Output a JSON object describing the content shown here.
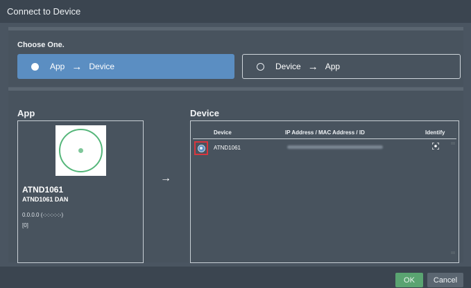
{
  "window": {
    "title": "Connect to Device"
  },
  "mode": {
    "heading": "Choose One.",
    "options": [
      {
        "from": "App",
        "to": "Device",
        "selected": true
      },
      {
        "from": "Device",
        "to": "App",
        "selected": false
      }
    ]
  },
  "app": {
    "title": "App",
    "name": "ATND1061",
    "dan_name": "ATND1061 DAN",
    "address": "0.0.0.0 (-:-:-:-:-:-)",
    "id": "[0]"
  },
  "transfer_arrow": "→",
  "device": {
    "title": "Device",
    "columns": [
      "Device",
      "IP Address / MAC Address / ID",
      "Identify"
    ],
    "rows": [
      {
        "device": "ATND1061"
      }
    ]
  },
  "footer": {
    "ok": "OK",
    "cancel": "Cancel"
  },
  "colors": {
    "accent": "#5b8ec2",
    "ok": "#5aa471",
    "highlight": "#d9363e"
  }
}
